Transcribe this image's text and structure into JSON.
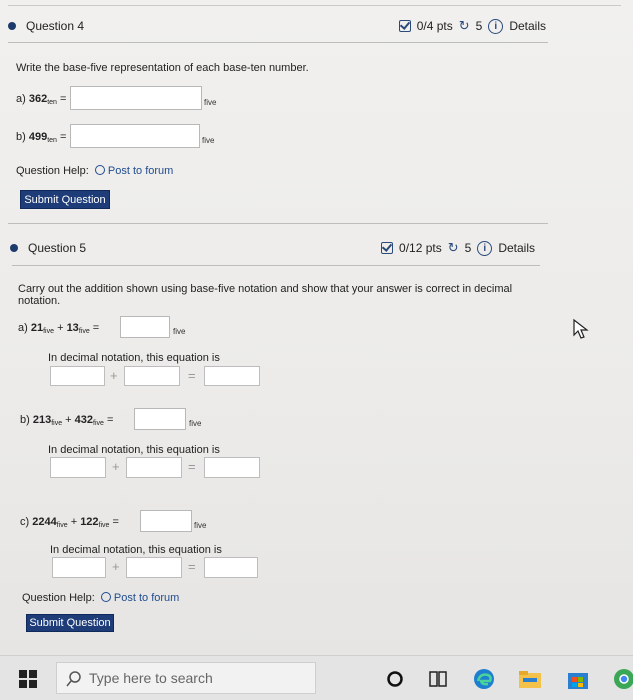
{
  "q4": {
    "title": "Question 4",
    "score": "0/4 pts",
    "tries": "5",
    "details": "Details",
    "prompt": "Write the base-five representation of each base-ten number.",
    "parts": [
      {
        "label": "a)",
        "number": "362",
        "sub": "ten",
        "equals": "=",
        "unit": "five"
      },
      {
        "label": "b)",
        "number": "499",
        "sub": "ten",
        "equals": "=",
        "unit": "five"
      }
    ],
    "help_label": "Question Help:",
    "help_link": "Post to forum",
    "submit": "Submit Question"
  },
  "q5": {
    "title": "Question 5",
    "score": "0/12 pts",
    "tries": "5",
    "details": "Details",
    "prompt": "Carry out the addition shown using base-five notation and show that your answer is correct in decimal notation.",
    "parts": [
      {
        "label": "a)",
        "n1": "21",
        "n2": "13",
        "sub": "five",
        "plus": "+",
        "equals": "=",
        "unit": "five",
        "decimal_text": "In decimal notation, this equation is"
      },
      {
        "label": "b)",
        "n1": "213",
        "n2": "432",
        "sub": "five",
        "plus": "+",
        "equals": "=",
        "unit": "five",
        "decimal_text": "In decimal notation, this equation is"
      },
      {
        "label": "c)",
        "n1": "2244",
        "n2": "122",
        "sub": "five",
        "plus": "+",
        "equals": "=",
        "unit": "five",
        "decimal_text": "In decimal notation, this equation is"
      }
    ],
    "help_label": "Question Help:",
    "help_link": "Post to forum",
    "submit": "Submit Question"
  },
  "taskbar": {
    "search_placeholder": "Type here to search"
  },
  "colors": {
    "accent": "#1d3c78",
    "link": "#1f4c8f"
  }
}
